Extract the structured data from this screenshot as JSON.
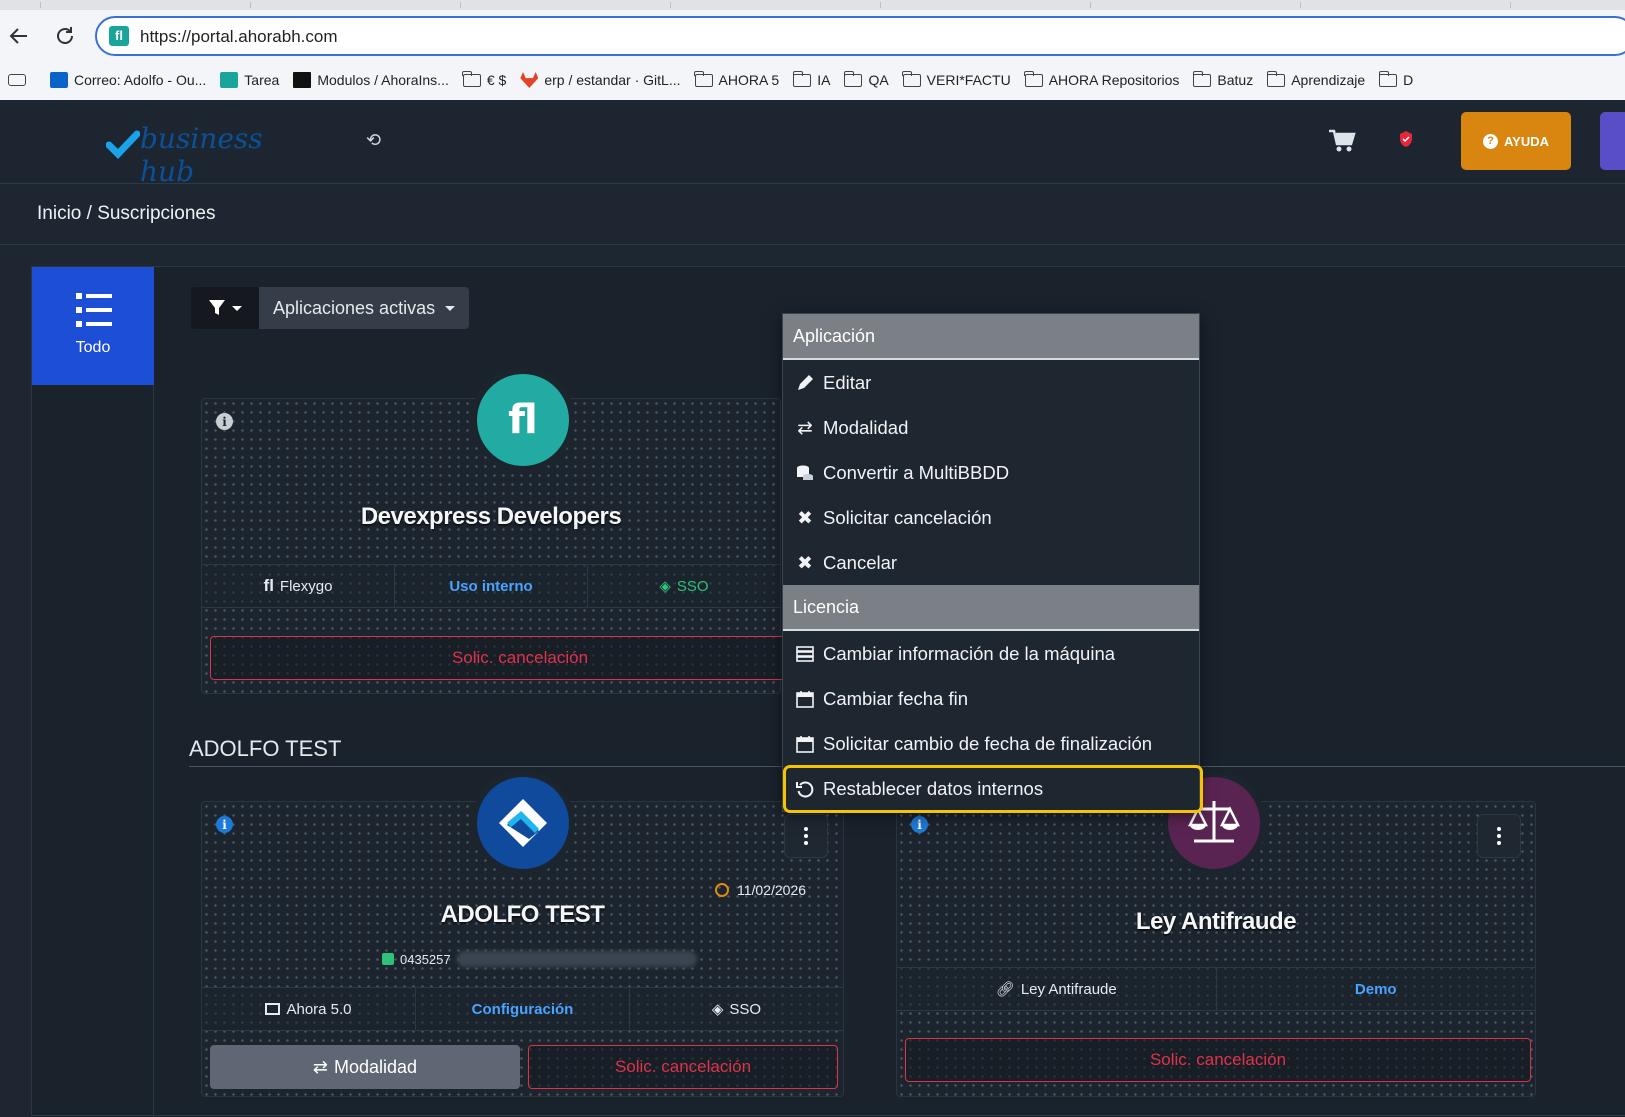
{
  "browser": {
    "url": "https://portal.ahorabh.com",
    "bookmarks": [
      {
        "label": "Correo: Adolfo - Ou...",
        "icon": "outlook-icon"
      },
      {
        "label": "Tarea",
        "icon": "flexygo-icon"
      },
      {
        "label": "Modulos / AhoraIns...",
        "icon": "teamcity-icon"
      },
      {
        "label": "€ $",
        "icon": "folder-icon"
      },
      {
        "label": "erp / estandar · GitL...",
        "icon": "gitlab-icon"
      },
      {
        "label": "AHORA 5",
        "icon": "folder-icon"
      },
      {
        "label": "IA",
        "icon": "folder-icon"
      },
      {
        "label": "QA",
        "icon": "folder-icon"
      },
      {
        "label": "VERI*FACTU",
        "icon": "folder-icon"
      },
      {
        "label": "AHORA Repositorios",
        "icon": "folder-icon"
      },
      {
        "label": "Batuz",
        "icon": "folder-icon"
      },
      {
        "label": "Aprendizaje",
        "icon": "folder-icon"
      },
      {
        "label": "D",
        "icon": "folder-icon"
      }
    ]
  },
  "header": {
    "logo_text": "business hub",
    "help_label": "AYUDA"
  },
  "breadcrumb": "Inicio / Suscripciones",
  "sidebar": {
    "todo_label": "Todo"
  },
  "filter": {
    "dropdown_label": "Aplicaciones activas"
  },
  "cards": {
    "devexpress": {
      "title": "Devexpress Developers",
      "product": "Flexygo",
      "usage": "Uso interno",
      "sso": "SSO",
      "cancel_label": "Solic. cancelación"
    },
    "group_title": "ADOLFO TEST",
    "adolfo": {
      "title": "ADOLFO TEST",
      "date": "11/02/2026",
      "license_id": "0435257",
      "product": "Ahora 5.0",
      "config": "Configuración",
      "sso": "SSO",
      "modalidad_label": "Modalidad",
      "cancel_label": "Solic. cancelación"
    },
    "ley": {
      "title": "Ley Antifraude",
      "product": "Ley Antifraude",
      "mode": "Demo",
      "cancel_label": "Solic. cancelación"
    }
  },
  "context_menu": {
    "section_app": "Aplicación",
    "edit": "Editar",
    "mode": "Modalidad",
    "convert": "Convertir a MultiBBDD",
    "request_cancel": "Solicitar cancelación",
    "cancel": "Cancelar",
    "section_license": "Licencia",
    "change_machine": "Cambiar información de la máquina",
    "change_end_date": "Cambiar fecha fin",
    "request_end_date": "Solicitar cambio de fecha de finalización",
    "reset_internal": "Restablecer datos internos"
  },
  "colors": {
    "accent_blue": "#1d4fd6",
    "help_orange": "#d8860f",
    "danger_red": "#d9344a",
    "highlight_yellow": "#f4c400"
  }
}
